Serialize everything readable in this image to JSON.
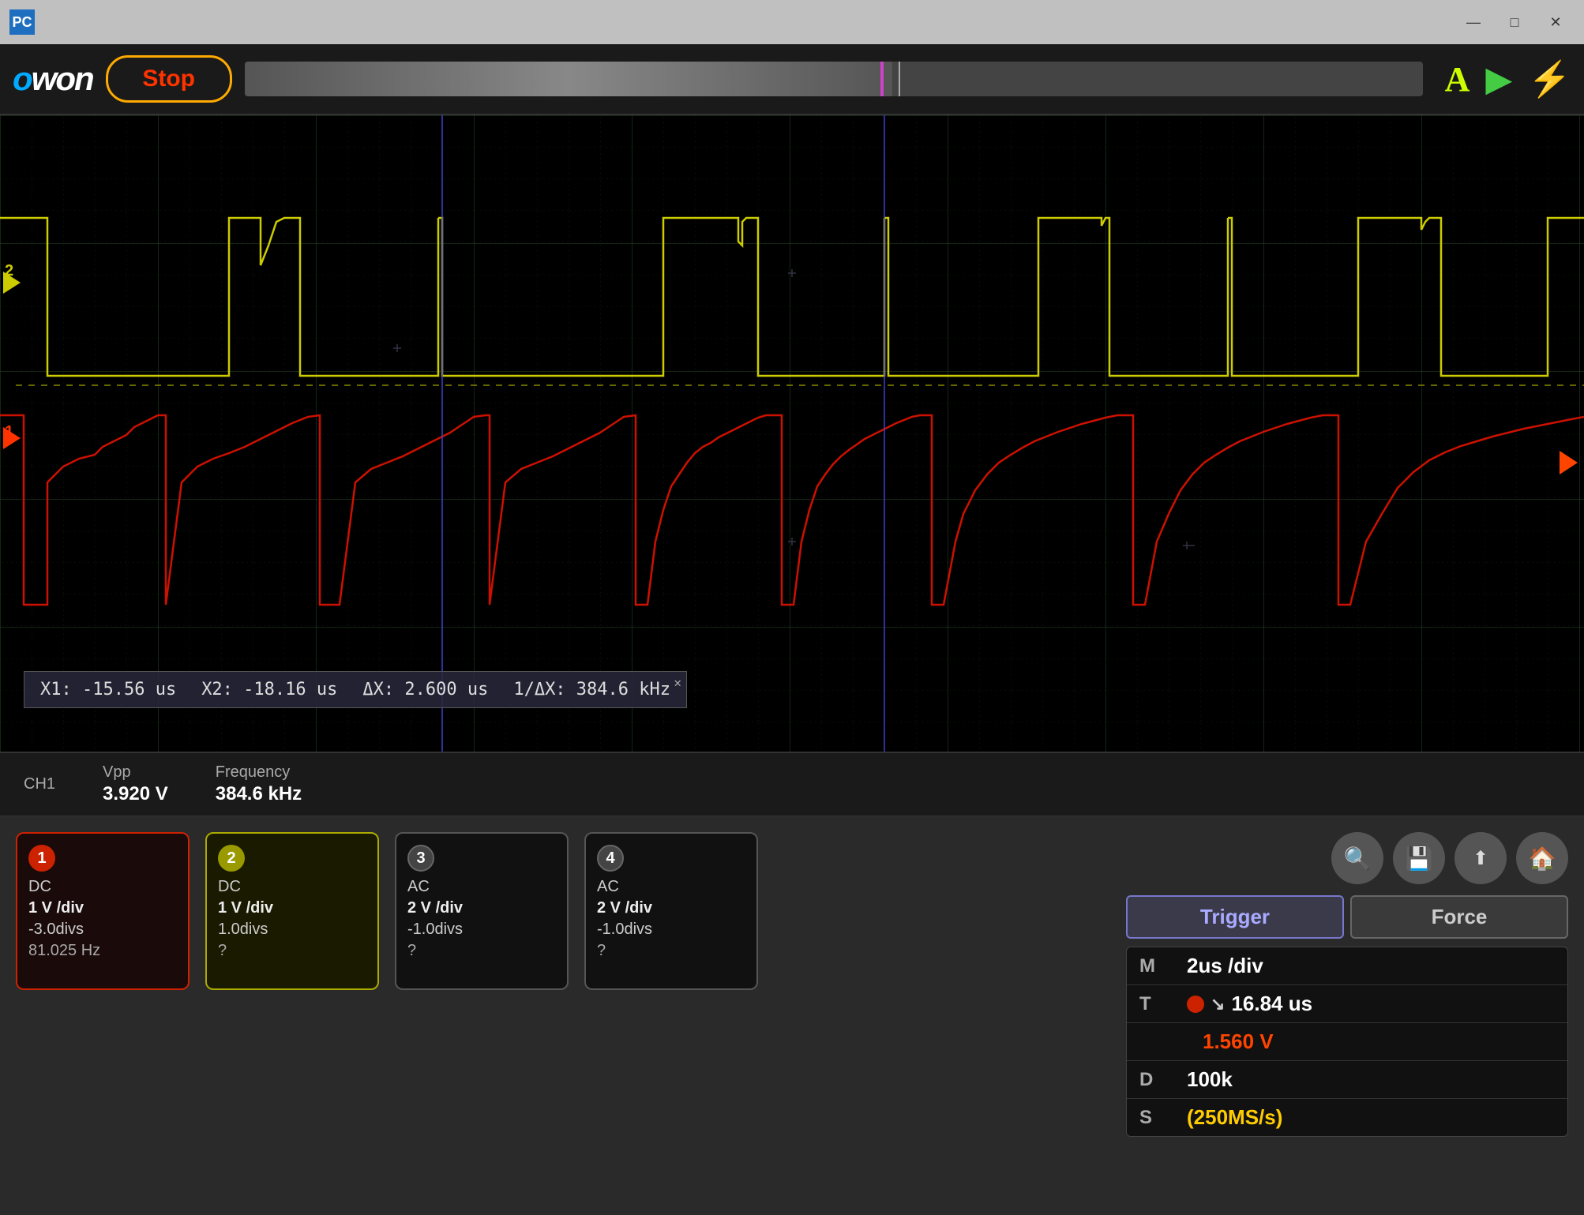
{
  "titlebar": {
    "icon": "PC",
    "title": "PC",
    "minimize": "—",
    "maximize": "□",
    "close": "✕"
  },
  "header": {
    "logo": "owon",
    "stop_label": "Stop",
    "icon_a": "A",
    "icon_play": "▶",
    "icon_bolt": "⚡"
  },
  "cursor_info": {
    "x1": "X1: -15.56 us",
    "x2": "X2: -18.16 us",
    "delta_x": "ΔX: 2.600 us",
    "inv_delta": "1/ΔX: 384.6 kHz"
  },
  "measurements": [
    {
      "label": "CH1",
      "sub_label": "",
      "name": "Vpp",
      "value": "3.920 V"
    },
    {
      "label": "",
      "sub_label": "",
      "name": "Frequency",
      "value": "384.6 kHz"
    }
  ],
  "channels": [
    {
      "num": "1",
      "coupling": "DC",
      "volts": "1 V /div",
      "divs": "-3.0divs",
      "extra": "81.025 Hz"
    },
    {
      "num": "2",
      "coupling": "DC",
      "volts": "1 V /div",
      "divs": "1.0divs",
      "extra": "?"
    },
    {
      "num": "3",
      "coupling": "AC",
      "volts": "2 V /div",
      "divs": "-1.0divs",
      "extra": "?"
    },
    {
      "num": "4",
      "coupling": "AC",
      "volts": "2 V /div",
      "divs": "-1.0divs",
      "extra": "?"
    }
  ],
  "settings": {
    "M": "2us /div",
    "T": "16.84 us",
    "D": "100k",
    "S": "(250MS/s)"
  },
  "trigger": {
    "trigger_label": "Trigger",
    "force_label": "Force",
    "channel_dot": "●",
    "slope": "↘",
    "value": "1.560 V"
  },
  "icons": {
    "search": "🔍",
    "save": "💾",
    "export": "⬆",
    "home": "🏠"
  }
}
